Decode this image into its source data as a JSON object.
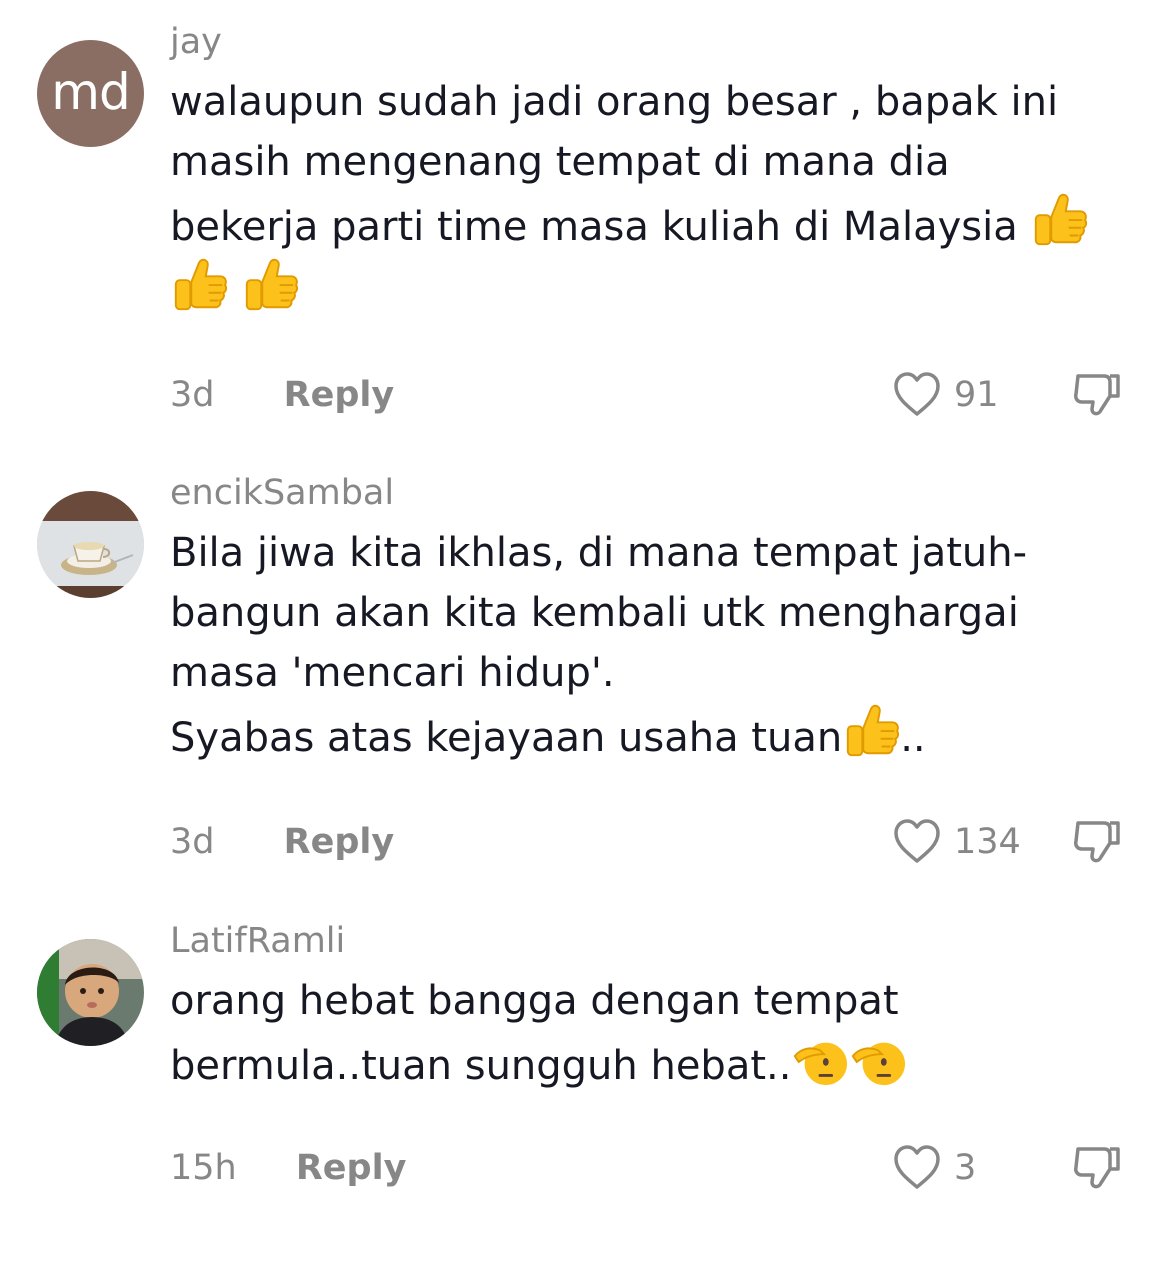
{
  "comments": [
    {
      "avatar_text": "md",
      "avatar_color": "#8a6e64",
      "username": "jay",
      "lines": [
        "walaupun sudah jadi orang besar , bapak ini",
        "masih mengenang tempat di mana dia",
        "bekerja parti time masa kuliah di Malaysia"
      ],
      "emoji_1": "thumbs-up",
      "emoji_2": "thumbs-up",
      "emoji_3": "thumbs-up",
      "time": "3d",
      "reply_label": "Reply",
      "likes": "91"
    },
    {
      "avatar": "coffee-cup-photo",
      "username": "encikSambal",
      "lines": [
        "Bila jiwa kita ikhlas, di mana tempat jatuh-",
        "bangun akan kita kembali utk menghargai",
        "masa 'mencari hidup'.",
        "Syabas atas kejayaan usaha tuan"
      ],
      "line4_tail": "..",
      "emoji_1": "thumbs-up",
      "time": "3d",
      "reply_label": "Reply",
      "likes": "134"
    },
    {
      "avatar": "child-photo",
      "username": "LatifRamli",
      "lines": [
        "orang hebat bangga dengan tempat",
        "bermula..tuan sungguh hebat.."
      ],
      "emoji_1": "saluting-face",
      "emoji_2": "saluting-face",
      "time": "15h",
      "reply_label": "Reply",
      "likes": "3"
    }
  ],
  "colors": {
    "text": "#161823",
    "secondary": "#878787",
    "emoji": "#fcc21b"
  }
}
